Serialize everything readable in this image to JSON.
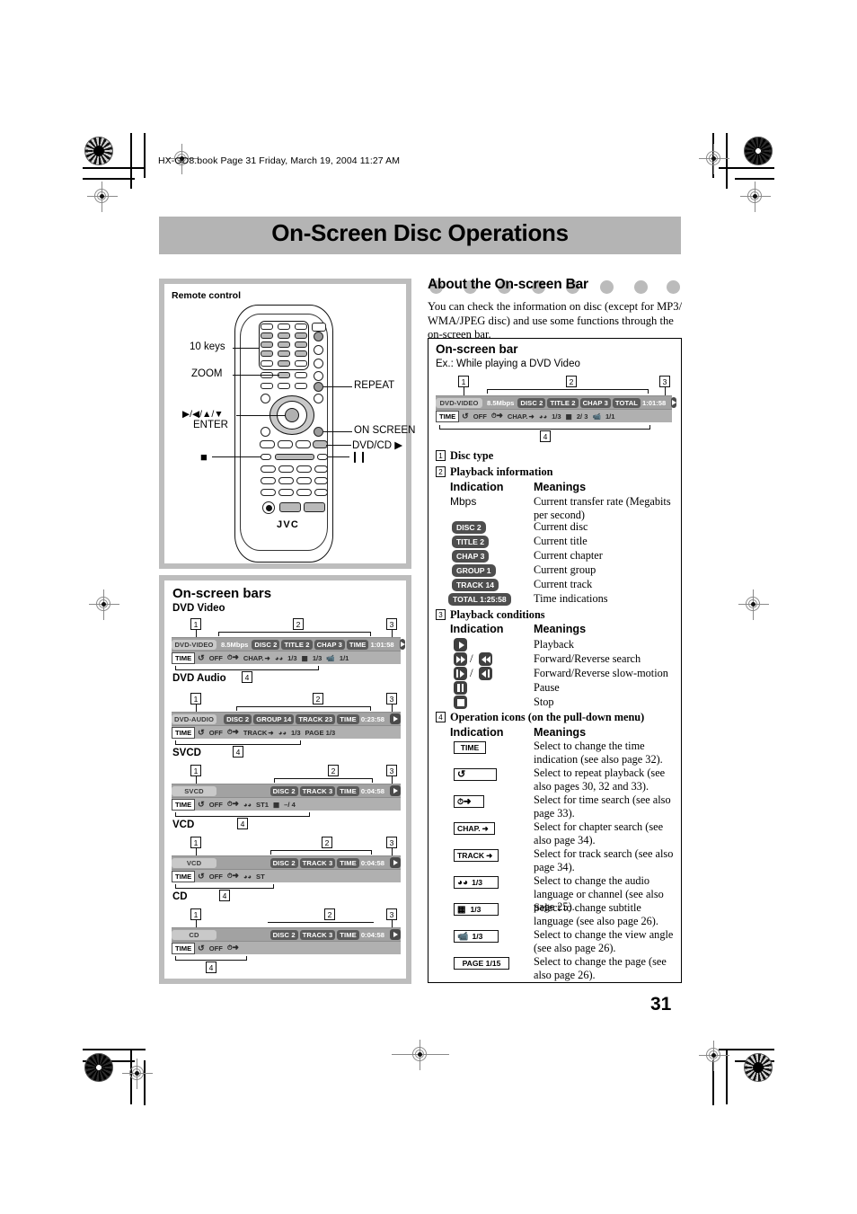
{
  "page": {
    "filestamp": "HX-GD8.book  Page 31  Friday, March 19, 2004  11:27 AM",
    "title": "On-Screen Disc Operations",
    "page_number": "31"
  },
  "left": {
    "remote_panel": {
      "heading": "Remote control",
      "brand": "JVC",
      "callouts": {
        "ten_keys": "10 keys",
        "zoom": "ZOOM",
        "arrows": "▶/◀/▲/▼",
        "enter": "ENTER",
        "stop": "■",
        "repeat": "REPEAT",
        "on_screen": "ON SCREEN",
        "dvd_cd": "DVD/CD ▶",
        "pause": "❙❙"
      }
    },
    "bars_panel": {
      "heading": "On-screen bars",
      "bars": [
        {
          "label": "DVD Video",
          "disc_type": "DVD-VIDEO",
          "rate": "8.5Mbps",
          "info": [
            "DISC 2",
            "TITLE  2",
            "CHAP  3"
          ],
          "time_label": "TIME",
          "time_value": "1:01:58",
          "ops": [
            "TIME",
            "OFF",
            "",
            "CHAP.",
            "1/3",
            "1/3",
            "1/1"
          ]
        },
        {
          "label": "DVD Audio",
          "disc_type": "DVD-AUDIO",
          "rate": "",
          "info": [
            "DISC 2",
            "GROUP 14",
            "TRACK 23"
          ],
          "time_label": "TIME",
          "time_value": "0:23:58",
          "ops": [
            "TIME",
            "OFF",
            "",
            "TRACK",
            "1/3",
            "PAGE 1/3"
          ]
        },
        {
          "label": "SVCD",
          "disc_type": "SVCD",
          "rate": "",
          "info": [
            "DISC 2",
            "TRACK  3"
          ],
          "time_label": "TIME",
          "time_value": "0:04:58",
          "ops": [
            "TIME",
            "OFF",
            "",
            "ST1",
            "–/ 4"
          ]
        },
        {
          "label": "VCD",
          "disc_type": "VCD",
          "rate": "",
          "info": [
            "DISC 2",
            "TRACK  3"
          ],
          "time_label": "TIME",
          "time_value": "0:04:58",
          "ops": [
            "TIME",
            "OFF",
            "",
            "ST"
          ]
        },
        {
          "label": "CD",
          "disc_type": "CD",
          "rate": "",
          "info": [
            "DISC 2",
            "TRACK  3"
          ],
          "time_label": "TIME",
          "time_value": "0:04:58",
          "ops": [
            "TIME",
            "OFF",
            ""
          ]
        }
      ],
      "callout_numbers": [
        "1",
        "2",
        "3",
        "4"
      ]
    }
  },
  "right": {
    "heading": "About the On-screen Bar",
    "intro": "You can check the information on disc (except for MP3/ WMA/JPEG disc) and use some functions through the on-screen bar.",
    "box": {
      "title": "On-screen bar",
      "example_caption": "Ex.: While playing a DVD Video",
      "example_bar": {
        "disc_type": "DVD-VIDEO",
        "rate": "8.5Mbps",
        "info": [
          "DISC 2",
          "TITLE  2",
          "CHAP  3"
        ],
        "time_label": "TOTAL",
        "time_value": "1:01:58",
        "ops": [
          "TIME",
          "OFF",
          "",
          "CHAP.",
          "1/3",
          "2/ 3",
          "1/1"
        ]
      },
      "callout_numbers": [
        "1",
        "2",
        "3",
        "4"
      ],
      "sections": [
        {
          "num": "1",
          "heading": "Disc type"
        },
        {
          "num": "2",
          "heading": "Playback information",
          "col_indication": "Indication",
          "col_meanings": "Meanings",
          "rows": [
            {
              "indication": "Mbps",
              "type": "text",
              "meaning": "Current transfer rate (Megabits per second)"
            },
            {
              "indication": "DISC 2",
              "type": "pill",
              "meaning": "Current disc"
            },
            {
              "indication": "TITLE  2",
              "type": "pill",
              "meaning": "Current title"
            },
            {
              "indication": "CHAP  3",
              "type": "pill",
              "meaning": "Current chapter"
            },
            {
              "indication": "GROUP 1",
              "type": "pill",
              "meaning": "Current group"
            },
            {
              "indication": "TRACK 14",
              "type": "pill",
              "meaning": "Current track"
            },
            {
              "indication": "TOTAL 1:25:58",
              "type": "pill",
              "meaning": "Time indications"
            }
          ]
        },
        {
          "num": "3",
          "heading": "Playback conditions",
          "col_indication": "Indication",
          "col_meanings": "Meanings",
          "rows": [
            {
              "icon": "play-icon",
              "meaning": "Playback"
            },
            {
              "icon": "fast-forward-rewind-icon",
              "meaning": "Forward/Reverse search"
            },
            {
              "icon": "slow-motion-icon",
              "meaning": "Forward/Reverse slow-motion"
            },
            {
              "icon": "pause-icon",
              "meaning": "Pause"
            },
            {
              "icon": "stop-icon",
              "meaning": "Stop"
            }
          ]
        },
        {
          "num": "4",
          "heading": "Operation icons (on the pull-down menu)",
          "col_indication": "Indication",
          "col_meanings": "Meanings",
          "rows": [
            {
              "indication": "TIME",
              "icon": "time-icon",
              "meaning": "Select to change the time indication (see also page 32)."
            },
            {
              "indication": "",
              "icon": "repeat-icon",
              "meaning": "Select to repeat playback (see also pages 30, 32 and 33)."
            },
            {
              "indication": "",
              "icon": "time-search-icon",
              "meaning": "Select for time search (see also page 33)."
            },
            {
              "indication": "CHAP.",
              "icon": "chapter-search-icon",
              "meaning": "Select for chapter search (see also page 34)."
            },
            {
              "indication": "TRACK",
              "icon": "track-search-icon",
              "meaning": "Select for track search (see also page 34)."
            },
            {
              "indication": "1/3",
              "icon": "audio-language-icon",
              "meaning": "Select to change the audio language or channel (see also page 25)."
            },
            {
              "indication": "1/3",
              "icon": "subtitle-icon",
              "meaning": "Select to change subtitle language (see also page 26)."
            },
            {
              "indication": "1/3",
              "icon": "view-angle-icon",
              "meaning": "Select to change the view angle (see also page 26)."
            },
            {
              "indication": "PAGE 1/15",
              "icon": "page-icon",
              "meaning": "Select to change the page (see also page 26)."
            }
          ]
        }
      ]
    }
  }
}
